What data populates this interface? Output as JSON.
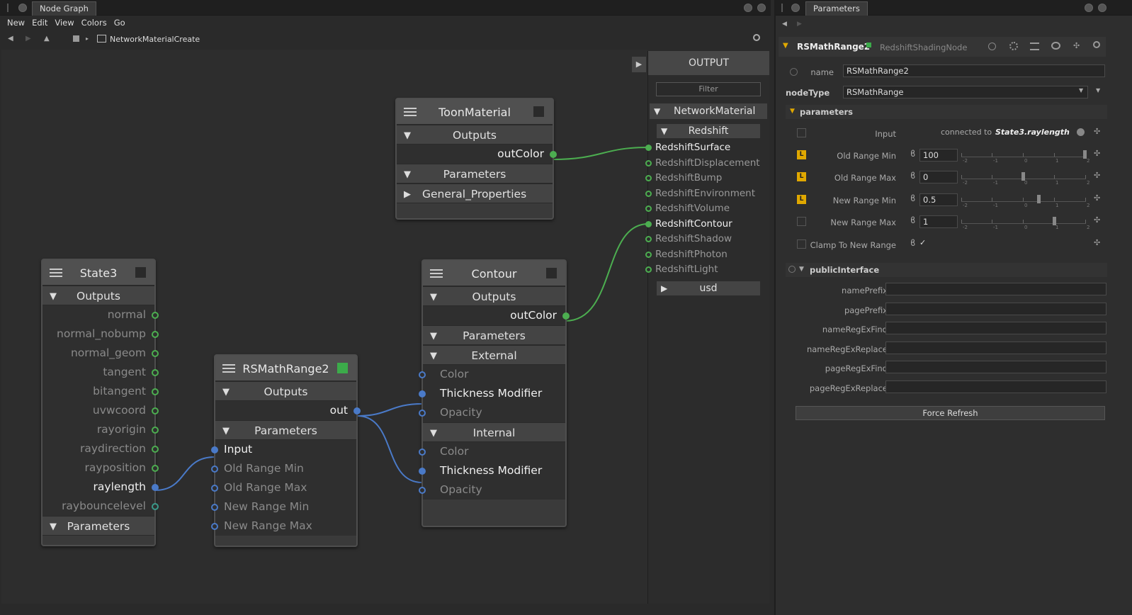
{
  "colors": {
    "green_link": "#4cae50",
    "blue_link": "#4a7ac8",
    "rsmath_swatch": "#3cab4a",
    "lock_yellow": "#e0a800"
  },
  "nodegraph": {
    "tab": "Node Graph",
    "menu": [
      "New",
      "Edit",
      "View",
      "Colors",
      "Go"
    ],
    "path": "NetworkMaterialCreate",
    "icons": [
      "back-icon",
      "forward-icon",
      "up-icon",
      "home-icon",
      "folder-icon",
      "search-icon"
    ]
  },
  "nodes": {
    "toon": {
      "title": "ToonMaterial",
      "outputs_label": "Outputs",
      "out": "outColor",
      "params_label": "Parameters",
      "group": "General_Properties"
    },
    "state": {
      "title": "State3",
      "outputs_label": "Outputs",
      "outs": [
        "normal",
        "normal_nobump",
        "normal_geom",
        "tangent",
        "bitangent",
        "uvwcoord",
        "rayorigin",
        "raydirection",
        "rayposition",
        "raylength",
        "raybouncelevel"
      ],
      "params_label": "Parameters"
    },
    "rsmath": {
      "title": "RSMathRange2",
      "outputs_label": "Outputs",
      "out": "out",
      "params_label": "Parameters",
      "ins": [
        "Input",
        "Old Range Min",
        "Old Range Max",
        "New Range Min",
        "New Range Max"
      ]
    },
    "contour": {
      "title": "Contour",
      "outputs_label": "Outputs",
      "out": "outColor",
      "params_label": "Parameters",
      "external_label": "External",
      "external": [
        "Color",
        "Thickness Modifier",
        "Opacity"
      ],
      "internal_label": "Internal",
      "internal": [
        "Color",
        "Thickness Modifier",
        "Opacity"
      ]
    }
  },
  "output": {
    "title": "OUTPUT",
    "filter": "Filter",
    "network": "NetworkMaterial",
    "redshift": "Redshift",
    "items": [
      "RedshiftSurface",
      "RedshiftDisplacement",
      "RedshiftBump",
      "RedshiftEnvironment",
      "RedshiftVolume",
      "RedshiftContour",
      "RedshiftShadow",
      "RedshiftPhoton",
      "RedshiftLight"
    ],
    "usd": "usd"
  },
  "params": {
    "tab": "Parameters",
    "node_name": "RSMathRange2",
    "node_class": "RedshiftShadingNode",
    "name_label": "name",
    "name_value": "RSMathRange2",
    "nodetype_label": "nodeType",
    "nodetype_value": "RSMathRange",
    "parameters_label": "parameters",
    "input_label": "Input",
    "input_prefix": "connected to",
    "input_value": "State3.raylength",
    "old_min_label": "Old Range Min",
    "old_min": "100",
    "old_max_label": "Old Range Max",
    "old_max": "0",
    "new_min_label": "New Range Min",
    "new_min": "0.5",
    "new_max_label": "New Range Max",
    "new_max": "1",
    "clamp_label": "Clamp To New Range",
    "clamp_mark": "✓",
    "slider_ticks": [
      "-2",
      "-1",
      "0",
      "1",
      "2"
    ],
    "lock_letter": "L",
    "public_label": "publicInterface",
    "public_fields": [
      "namePrefix",
      "pagePrefix",
      "nameRegExFind",
      "nameRegExReplace",
      "pageRegExFind",
      "pageRegExReplace"
    ],
    "refresh": "Force Refresh"
  }
}
